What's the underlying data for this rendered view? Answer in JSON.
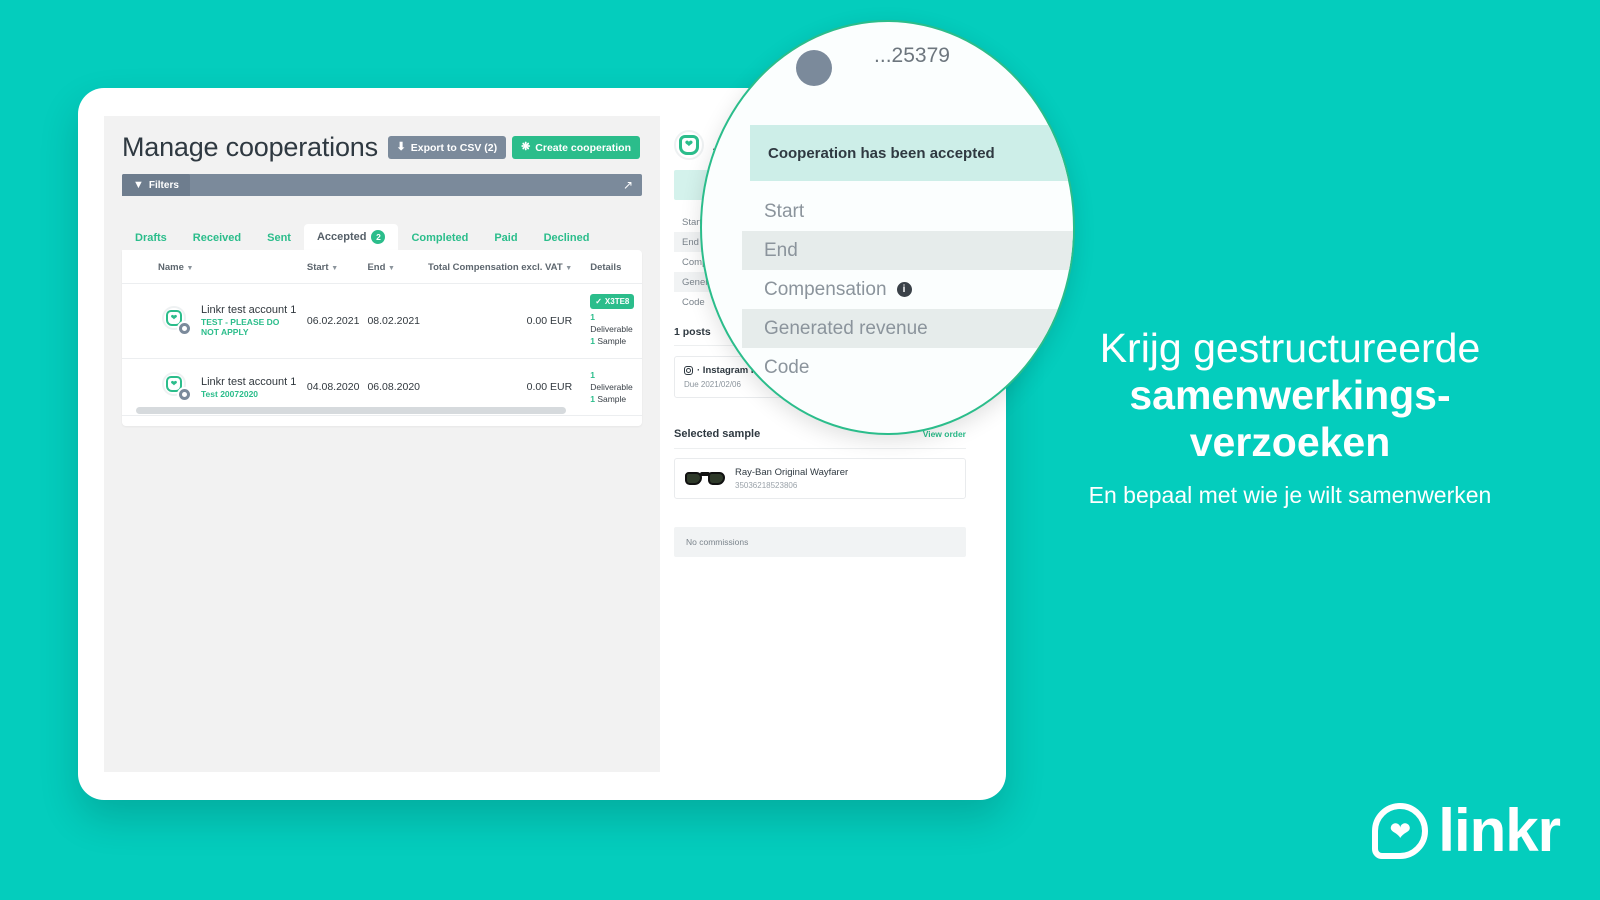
{
  "background_color": "#04cdbd",
  "app": {
    "page_title": "Manage cooperations",
    "buttons": {
      "export_label": "Export to CSV (2)",
      "export_icon": "download-icon",
      "create_label": "Create cooperation",
      "create_icon": "plus-circle-icon",
      "export_color": "#7b8a9b",
      "create_color": "#2bbd8b"
    },
    "filters": {
      "label": "Filters",
      "filter_icon": "funnel-icon",
      "expand_icon": "expand-arrows-icon"
    },
    "tabs": [
      {
        "label": "Drafts",
        "active": false
      },
      {
        "label": "Received",
        "active": false
      },
      {
        "label": "Sent",
        "active": false
      },
      {
        "label": "Accepted",
        "active": true,
        "badge": "2"
      },
      {
        "label": "Completed",
        "active": false
      },
      {
        "label": "Paid",
        "active": false
      },
      {
        "label": "Declined",
        "active": false
      }
    ],
    "table": {
      "columns": [
        "Name",
        "Start",
        "End",
        "Total Compensation excl. VAT",
        "Details"
      ],
      "rows": [
        {
          "name": "Linkr test account 1",
          "subtitle": "TEST - PLEASE DO NOT APPLY",
          "start": "06.02.2021",
          "end": "08.02.2021",
          "compensation": "0.00 EUR",
          "code_badge": "X3TE8",
          "deliverable": "1  Deliverable",
          "deliverable_count": "1",
          "deliverable_label": "Deliverable",
          "sample_count": "1",
          "sample_label": "Sample"
        },
        {
          "name": "Linkr test account 1",
          "subtitle": "Test 20072020",
          "start": "04.08.2020",
          "end": "06.08.2020",
          "compensation": "0.00 EUR",
          "code_badge": "",
          "deliverable_count": "1",
          "deliverable_label": "Deliverable",
          "sample_count": "1",
          "sample_label": "Sample"
        }
      ]
    }
  },
  "detail_panel": {
    "cooperation_id": "...25379",
    "status_banner": "Cooperation has been accepted",
    "fields": [
      {
        "label": "Start"
      },
      {
        "label": "End"
      },
      {
        "label": "Compensation",
        "has_info_icon": true
      },
      {
        "label": "Generated revenue"
      },
      {
        "label": "Code"
      }
    ],
    "posts_label": "1 posts",
    "post": {
      "title": "Instagram Post",
      "title_truncated": "· Instagram Po",
      "due": "Due 2021/02/06",
      "icon": "instagram-icon"
    },
    "sample_section": {
      "title": "Selected sample",
      "link": "View order",
      "product_name": "Ray-Ban Original Wayfarer",
      "product_sku": "35036218523806"
    },
    "commissions": "No commissions"
  },
  "magnifier": {
    "clipped_id": "...25379",
    "banner": "Cooperation has been accepted",
    "rows": [
      {
        "label": "Start",
        "alt": false
      },
      {
        "label": "End",
        "alt": true
      },
      {
        "label": "Compensation",
        "alt": false,
        "info": "i"
      },
      {
        "label": "Generated revenue",
        "alt": true
      },
      {
        "label": "Code",
        "alt": false
      }
    ]
  },
  "promo": {
    "line1": "Krijg gestructureerde",
    "line2": "samenwerkings-",
    "line3": "verzoeken",
    "subtitle": "En bepaal met wie je wilt samenwerken"
  },
  "logo": {
    "text": "linkr",
    "mark": "heart-shield-icon"
  }
}
